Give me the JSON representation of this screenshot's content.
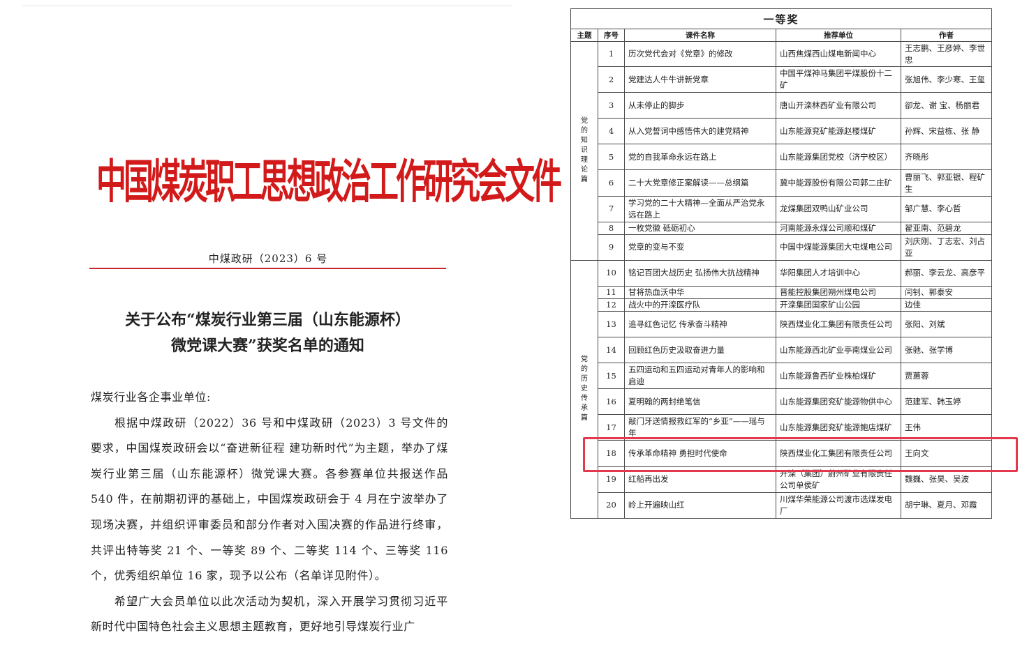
{
  "letter": {
    "header": "中国煤炭职工思想政治工作研究会文件",
    "doc_number": "中煤政研（2023）6 号",
    "title_line1": "关于公布“煤炭行业第三届（山东能源杯）",
    "title_line2": "微党课大赛”获奖名单的通知",
    "salutation": "煤炭行业各企事业单位:",
    "para1": "根据中煤政研（2022）36 号和中煤政研（2023）3 号文件的要求，中国煤炭政研会以“奋进新征程 建功新时代”为主题，举办了煤炭行业第三届（山东能源杯）微党课大赛。各参赛单位共报送作品 540 件，在前期初评的基础上，中国煤炭政研会于 4 月在宁波举办了现场决赛，并组织评审委员和部分作者对入围决赛的作品进行终审，共评出特等奖 21 个、一等奖 89 个、二等奖 114 个、三等奖 116 个，优秀组织单位 16 家，现予以公布（名单详见附件）。",
    "para2": "希望广大会员单位以此次活动为契机，深入开展学习贯彻习近平新时代中国特色社会主义思想主题教育，更好地引导煤炭行业广"
  },
  "table": {
    "caption": "一等奖",
    "headers": [
      "主题",
      "序号",
      "课件名称",
      "推荐单位",
      "作者"
    ],
    "group1_theme": "党的知识理论篇",
    "group2_theme": "党的历史传承篇",
    "rows": [
      {
        "no": "1",
        "title": "历次党代会对《党章》的修改",
        "unit": "山西焦煤西山煤电新闻中心",
        "author": "王志鹏、王彦婷、李世忠"
      },
      {
        "no": "2",
        "title": "党建达人牛牛讲新党章",
        "unit": "中国平煤神马集团平煤股份十二矿",
        "author": "张旭伟、李少寒、王玺"
      },
      {
        "no": "3",
        "title": "从未停止的脚步",
        "unit": "唐山开滦林西矿业有限公司",
        "author": "卻龙、谢 宝、杨丽君"
      },
      {
        "no": "4",
        "title": "从入党誓词中感悟伟大的建党精神",
        "unit": "山东能源兖矿能源赵楼煤矿",
        "author": "孙辉、宋益栋、张 静"
      },
      {
        "no": "5",
        "title": "党的自我革命永远在路上",
        "unit": "山东能源集团党校（济宁校区）",
        "author": "齐晓彤"
      },
      {
        "no": "6",
        "title": "二十大党章修正案解读——总纲篇",
        "unit": "冀中能源股份有限公司郭二庄矿",
        "author": "曹丽飞、郭亚银、程矿生"
      },
      {
        "no": "7",
        "title": "学习党的二十大精神—全面从严治党永远在路上",
        "unit": "龙煤集团双鸭山矿业公司",
        "author": "邹广慧、李心哲"
      },
      {
        "no": "8",
        "title": "一枚党徽 砥砺初心",
        "unit": "河南能源永煤公司顺和煤矿",
        "author": "翟亚南、范碧龙"
      },
      {
        "no": "9",
        "title": "党章的变与不变",
        "unit": "中国中煤能源集团大屯煤电公司",
        "author": "刘庆刚、丁志宏、刘占亚"
      },
      {
        "no": "10",
        "title": "铭记百团大战历史 弘扬伟大抗战精神",
        "unit": "华阳集团人才培训中心",
        "author": "郝丽、李云龙、高彦平"
      },
      {
        "no": "11",
        "title": "甘将热血沃中华",
        "unit": "晋能控股集团朔州煤电公司",
        "author": "闫钊、郭泰安"
      },
      {
        "no": "12",
        "title": "战火中的开滦医疗队",
        "unit": "开滦集团国家矿山公园",
        "author": "边佳"
      },
      {
        "no": "13",
        "title": "追寻红色记忆 传承奋斗精神",
        "unit": "陕西煤业化工集团有限责任公司",
        "author": "张阳、刘斌"
      },
      {
        "no": "14",
        "title": "回顾红色历史汲取奋进力量",
        "unit": "山东能源西北矿业亭南煤业公司",
        "author": "张驰、张学博"
      },
      {
        "no": "15",
        "title": "五四运动和五四运动对青年人的影响和启迪",
        "unit": "山东能源鲁西矿业株柏煤矿",
        "author": "贾蕙蓉"
      },
      {
        "no": "16",
        "title": "夏明翰的两封绝笔信",
        "unit": "山东能源集团兖矿能源物供中心",
        "author": "范建军、韩玉婷"
      },
      {
        "no": "17",
        "title": "敲门牙送情报救红军的“乡亚”——瑶与年",
        "unit": "山东能源集团兖矿能源鲍店煤矿",
        "author": "王伟"
      },
      {
        "no": "18",
        "title": "传承革命精神 勇担时代使命",
        "unit": "陕西煤业化工集团有限责任公司",
        "author": "王向文"
      },
      {
        "no": "19",
        "title": "红船再出发",
        "unit": "开滦（集团）蔚州矿业有限责任公司单侯矿",
        "author": "魏巍、张昊、吴波"
      },
      {
        "no": "20",
        "title": "岭上开遍映山红",
        "unit": "川煤华荣能源公司渡市选煤发电厂",
        "author": "胡宁琳、夏月、邓霞"
      }
    ]
  },
  "colors": {
    "letterhead_red": "#d21a1a",
    "rule_red": "#c8262b",
    "highlight_red": "#e23a4c"
  }
}
